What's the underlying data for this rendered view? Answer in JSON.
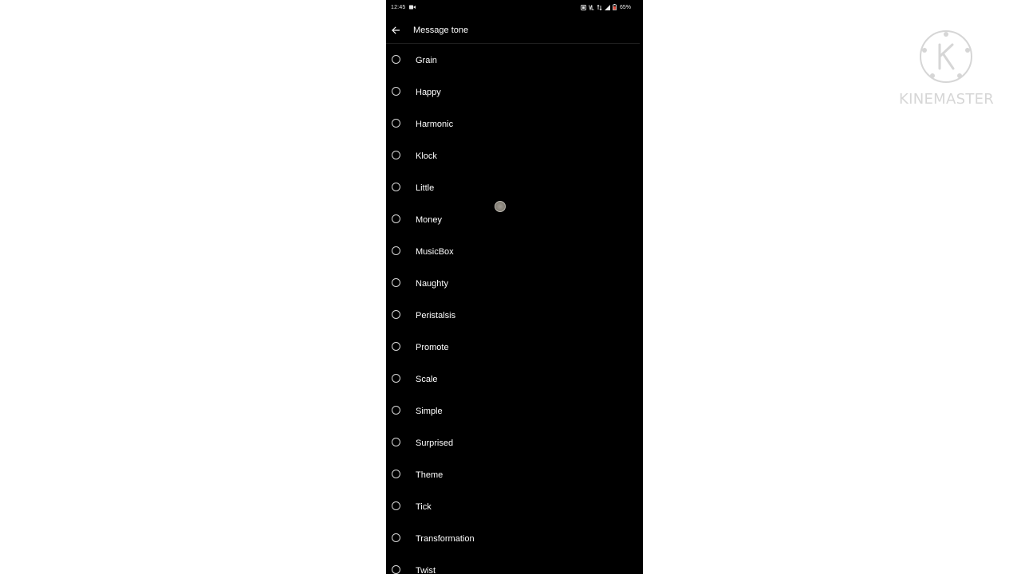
{
  "status_bar": {
    "time": "12:45",
    "battery": "65%"
  },
  "header": {
    "title": "Message tone"
  },
  "tones": [
    {
      "label": "Grain"
    },
    {
      "label": "Happy"
    },
    {
      "label": "Harmonic"
    },
    {
      "label": "Klock"
    },
    {
      "label": "Little"
    },
    {
      "label": "Money"
    },
    {
      "label": "MusicBox"
    },
    {
      "label": "Naughty"
    },
    {
      "label": "Peristalsis"
    },
    {
      "label": "Promote"
    },
    {
      "label": "Scale"
    },
    {
      "label": "Simple"
    },
    {
      "label": "Surprised"
    },
    {
      "label": "Theme"
    },
    {
      "label": "Tick"
    },
    {
      "label": "Transformation"
    },
    {
      "label": "Twist"
    }
  ],
  "watermark": {
    "text": "KINEMASTER",
    "logo_letter": "K"
  },
  "colors": {
    "screen_background": "#000000",
    "text": "#ffffff",
    "watermark": "#d6d6d6"
  },
  "icons": {
    "back": "arrow-back-icon",
    "radio": "radio-unselected-icon"
  }
}
